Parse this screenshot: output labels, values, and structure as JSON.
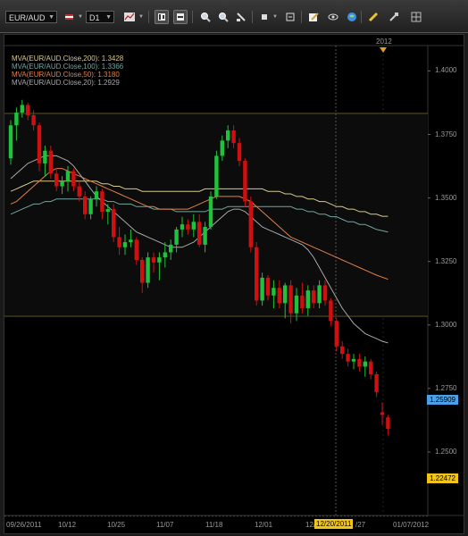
{
  "toolbar": {
    "symbol": "EUR/AUD",
    "timeframe": "D1",
    "icons": [
      "symbol-dropdown",
      "flag-icon",
      "timeframe-dropdown",
      "line-chart-icon",
      "bar-chart-icon",
      "candle-chart-icon",
      "zoom-in-icon",
      "zoom-out-icon",
      "scale-icon",
      "indicator-icon",
      "object-icon",
      "edit-icon",
      "refresh-icon",
      "save-icon",
      "globe-icon",
      "pencil-icon",
      "settings-icon",
      "grid-icon"
    ]
  },
  "chart": {
    "year_marker": "2012",
    "legend": [
      {
        "text": "MVA(EUR/AUD.Close,200): 1.3428",
        "color": "#d9c98a"
      },
      {
        "text": "MVA(EUR/AUD.Close,100): 1.3366",
        "color": "#6fa7a0"
      },
      {
        "text": "MVA(EUR/AUD.Close,50): 1.3180",
        "color": "#e0804a"
      },
      {
        "text": "MVA(EUR/AUD.Close,20): 1.2929",
        "color": "#a8a8a8"
      }
    ],
    "current_price": "1.25909",
    "cursor_price": "1.22472",
    "cursor_date": "12/20/2011",
    "y_ticks": [
      "1.4000",
      "1.3750",
      "1.3500",
      "1.3250",
      "1.3000",
      "1.2750",
      "1.2500"
    ],
    "x_ticks": [
      "09/26/2011",
      "10/12",
      "10/25",
      "11/07",
      "11/18",
      "12/01",
      "12/",
      "/27",
      "01/07/2012"
    ],
    "colors": {
      "bull": "#1fc23b",
      "bear": "#d01010",
      "hline": "#c8b840",
      "price_tag": "#4aa0e8",
      "cursor_tag": "#f0c419"
    }
  },
  "chart_data": {
    "type": "candlestick",
    "symbol": "EUR/AUD",
    "timeframe": "D1",
    "ylim": [
      1.225,
      1.41
    ],
    "horizontal_lines": [
      1.3832,
      1.3035
    ],
    "candles": [
      [
        1.3656,
        1.3806,
        1.3631,
        1.3786
      ],
      [
        1.3786,
        1.3856,
        1.3726,
        1.3836
      ],
      [
        1.3836,
        1.3886,
        1.3816,
        1.3866
      ],
      [
        1.3866,
        1.3876,
        1.3806,
        1.3826
      ],
      [
        1.3826,
        1.3846,
        1.3766,
        1.3786
      ],
      [
        1.3786,
        1.3796,
        1.3606,
        1.3636
      ],
      [
        1.3636,
        1.3706,
        1.3586,
        1.3686
      ],
      [
        1.3686,
        1.3706,
        1.3576,
        1.3596
      ],
      [
        1.3596,
        1.3616,
        1.3526,
        1.3546
      ],
      [
        1.3546,
        1.3586,
        1.3516,
        1.3566
      ],
      [
        1.3566,
        1.3626,
        1.3526,
        1.3606
      ],
      [
        1.3606,
        1.3616,
        1.3526,
        1.3546
      ],
      [
        1.3546,
        1.3566,
        1.3486,
        1.3506
      ],
      [
        1.3506,
        1.3526,
        1.3416,
        1.3436
      ],
      [
        1.3436,
        1.3506,
        1.3416,
        1.3496
      ],
      [
        1.3496,
        1.3546,
        1.3466,
        1.3526
      ],
      [
        1.3526,
        1.3536,
        1.3416,
        1.3446
      ],
      [
        1.3446,
        1.3476,
        1.3396,
        1.3456
      ],
      [
        1.3456,
        1.3476,
        1.3326,
        1.3346
      ],
      [
        1.3346,
        1.3386,
        1.3276,
        1.3306
      ],
      [
        1.3306,
        1.3356,
        1.3276,
        1.3326
      ],
      [
        1.3326,
        1.3376,
        1.3306,
        1.3336
      ],
      [
        1.3336,
        1.3346,
        1.3236,
        1.3256
      ],
      [
        1.3256,
        1.3266,
        1.3126,
        1.3166
      ],
      [
        1.3166,
        1.3286,
        1.3146,
        1.3266
      ],
      [
        1.3266,
        1.3286,
        1.3206,
        1.3246
      ],
      [
        1.3246,
        1.3286,
        1.3176,
        1.3266
      ],
      [
        1.3266,
        1.3326,
        1.3226,
        1.3286
      ],
      [
        1.3286,
        1.3336,
        1.3256,
        1.3316
      ],
      [
        1.3316,
        1.3386,
        1.3286,
        1.3376
      ],
      [
        1.3376,
        1.3426,
        1.3346,
        1.3396
      ],
      [
        1.3396,
        1.3416,
        1.3356,
        1.3376
      ],
      [
        1.3376,
        1.3436,
        1.3346,
        1.3406
      ],
      [
        1.3406,
        1.3436,
        1.3306,
        1.3316
      ],
      [
        1.3316,
        1.3406,
        1.3286,
        1.3386
      ],
      [
        1.3386,
        1.3526,
        1.3376,
        1.3506
      ],
      [
        1.3506,
        1.3686,
        1.3496,
        1.3666
      ],
      [
        1.3666,
        1.3746,
        1.3646,
        1.3726
      ],
      [
        1.3726,
        1.3786,
        1.3696,
        1.3766
      ],
      [
        1.3766,
        1.3786,
        1.3696,
        1.3716
      ],
      [
        1.3716,
        1.3736,
        1.3626,
        1.3646
      ],
      [
        1.3646,
        1.3656,
        1.3466,
        1.3486
      ],
      [
        1.3486,
        1.3506,
        1.3286,
        1.3306
      ],
      [
        1.3306,
        1.3326,
        1.3076,
        1.3096
      ],
      [
        1.3096,
        1.3206,
        1.3076,
        1.3186
      ],
      [
        1.3186,
        1.3196,
        1.3096,
        1.3116
      ],
      [
        1.3116,
        1.3176,
        1.3066,
        1.3146
      ],
      [
        1.3146,
        1.3176,
        1.3066,
        1.3086
      ],
      [
        1.3086,
        1.3166,
        1.3026,
        1.3156
      ],
      [
        1.3156,
        1.3176,
        1.3006,
        1.3046
      ],
      [
        1.3046,
        1.3146,
        1.3016,
        1.3116
      ],
      [
        1.3116,
        1.3166,
        1.3046,
        1.3066
      ],
      [
        1.3066,
        1.3156,
        1.3036,
        1.3136
      ],
      [
        1.3136,
        1.3156,
        1.3066,
        1.3086
      ],
      [
        1.3086,
        1.3176,
        1.3066,
        1.3156
      ],
      [
        1.3156,
        1.3176,
        1.3076,
        1.3096
      ],
      [
        1.3096,
        1.3106,
        1.2996,
        1.3016
      ],
      [
        1.3016,
        1.3026,
        1.2896,
        1.2916
      ],
      [
        1.2916,
        1.2936,
        1.2866,
        1.2886
      ],
      [
        1.2886,
        1.2906,
        1.2836,
        1.2856
      ],
      [
        1.2856,
        1.2886,
        1.2826,
        1.2866
      ],
      [
        1.2866,
        1.2886,
        1.2816,
        1.2836
      ],
      [
        1.2836,
        1.2876,
        1.2796,
        1.2856
      ],
      [
        1.2856,
        1.2866,
        1.2786,
        1.2806
      ],
      [
        1.2806,
        1.2816,
        1.2716,
        1.2736
      ],
      [
        1.2656,
        1.2696,
        1.2606,
        1.2646
      ],
      [
        1.2636,
        1.2646,
        1.2566,
        1.2591
      ]
    ],
    "ma_series": [
      {
        "name": "MVA(EUR/AUD.Close,200)",
        "color": "#d9c98a",
        "values": [
          1.3526,
          1.3536,
          1.3546,
          1.3556,
          1.3566,
          1.3566,
          1.3566,
          1.3566,
          1.3566,
          1.3566,
          1.3566,
          1.3566,
          1.3566,
          1.3566,
          1.3566,
          1.3566,
          1.3556,
          1.3556,
          1.3546,
          1.3546,
          1.3536,
          1.3536,
          1.3536,
          1.3526,
          1.3526,
          1.3526,
          1.3526,
          1.3526,
          1.3526,
          1.3526,
          1.3526,
          1.3526,
          1.3526,
          1.3526,
          1.3536,
          1.3536,
          1.3536,
          1.3536,
          1.3536,
          1.3536,
          1.3536,
          1.3536,
          1.3536,
          1.3536,
          1.3536,
          1.3526,
          1.3526,
          1.3526,
          1.3516,
          1.3516,
          1.3506,
          1.3506,
          1.3496,
          1.3496,
          1.3486,
          1.3486,
          1.3476,
          1.3466,
          1.3466,
          1.3456,
          1.3456,
          1.3446,
          1.3446,
          1.3436,
          1.3436,
          1.3428,
          1.3428
        ]
      },
      {
        "name": "MVA(EUR/AUD.Close,100)",
        "color": "#6fa7a0",
        "values": [
          1.3436,
          1.3446,
          1.3456,
          1.3466,
          1.3476,
          1.3476,
          1.3486,
          1.3486,
          1.3496,
          1.3496,
          1.3496,
          1.3496,
          1.3496,
          1.3496,
          1.3496,
          1.3496,
          1.3496,
          1.3486,
          1.3486,
          1.3476,
          1.3476,
          1.3476,
          1.3466,
          1.3466,
          1.3466,
          1.3456,
          1.3456,
          1.3456,
          1.3456,
          1.3446,
          1.3446,
          1.3446,
          1.3446,
          1.3446,
          1.3446,
          1.3456,
          1.3456,
          1.3456,
          1.3466,
          1.3466,
          1.3466,
          1.3466,
          1.3466,
          1.3466,
          1.3466,
          1.3466,
          1.3466,
          1.3466,
          1.3466,
          1.3466,
          1.3456,
          1.3456,
          1.3446,
          1.3446,
          1.3436,
          1.3436,
          1.3426,
          1.3426,
          1.3416,
          1.3406,
          1.3406,
          1.3396,
          1.3396,
          1.3386,
          1.3376,
          1.3371,
          1.3366
        ]
      },
      {
        "name": "MVA(EUR/AUD.Close,50)",
        "color": "#e0804a",
        "values": [
          1.3476,
          1.3486,
          1.3506,
          1.3526,
          1.3546,
          1.3566,
          1.3586,
          1.3606,
          1.3616,
          1.3616,
          1.3606,
          1.3596,
          1.3586,
          1.3576,
          1.3566,
          1.3556,
          1.3546,
          1.3536,
          1.3526,
          1.3516,
          1.3506,
          1.3496,
          1.3486,
          1.3476,
          1.3466,
          1.3466,
          1.3456,
          1.3456,
          1.3456,
          1.3456,
          1.3456,
          1.3456,
          1.3466,
          1.3476,
          1.3486,
          1.3496,
          1.3506,
          1.3506,
          1.3506,
          1.3506,
          1.3506,
          1.3496,
          1.3486,
          1.3466,
          1.3446,
          1.3426,
          1.3406,
          1.3386,
          1.3366,
          1.3346,
          1.3336,
          1.3326,
          1.3316,
          1.3306,
          1.3296,
          1.3286,
          1.3276,
          1.3266,
          1.3256,
          1.3246,
          1.3236,
          1.3226,
          1.3216,
          1.3206,
          1.3196,
          1.3188,
          1.318
        ]
      },
      {
        "name": "MVA(EUR/AUD.Close,20)",
        "color": "#a8a8a8",
        "values": [
          1.3576,
          1.3596,
          1.3616,
          1.3636,
          1.3646,
          1.3656,
          1.3666,
          1.3666,
          1.3666,
          1.3656,
          1.3646,
          1.3626,
          1.3596,
          1.3566,
          1.3536,
          1.3506,
          1.3486,
          1.3466,
          1.3446,
          1.3426,
          1.3406,
          1.3386,
          1.3366,
          1.3356,
          1.3346,
          1.3336,
          1.3326,
          1.3316,
          1.3306,
          1.3306,
          1.3306,
          1.3316,
          1.3326,
          1.3346,
          1.3366,
          1.3386,
          1.3406,
          1.3426,
          1.3446,
          1.3456,
          1.3456,
          1.3446,
          1.3426,
          1.3406,
          1.3386,
          1.3376,
          1.3366,
          1.3356,
          1.3346,
          1.3336,
          1.3326,
          1.3316,
          1.3296,
          1.3266,
          1.3226,
          1.3186,
          1.3146,
          1.3106,
          1.3066,
          1.3036,
          1.3006,
          1.2986,
          1.2966,
          1.2956,
          1.2946,
          1.2936,
          1.2929
        ]
      }
    ]
  }
}
